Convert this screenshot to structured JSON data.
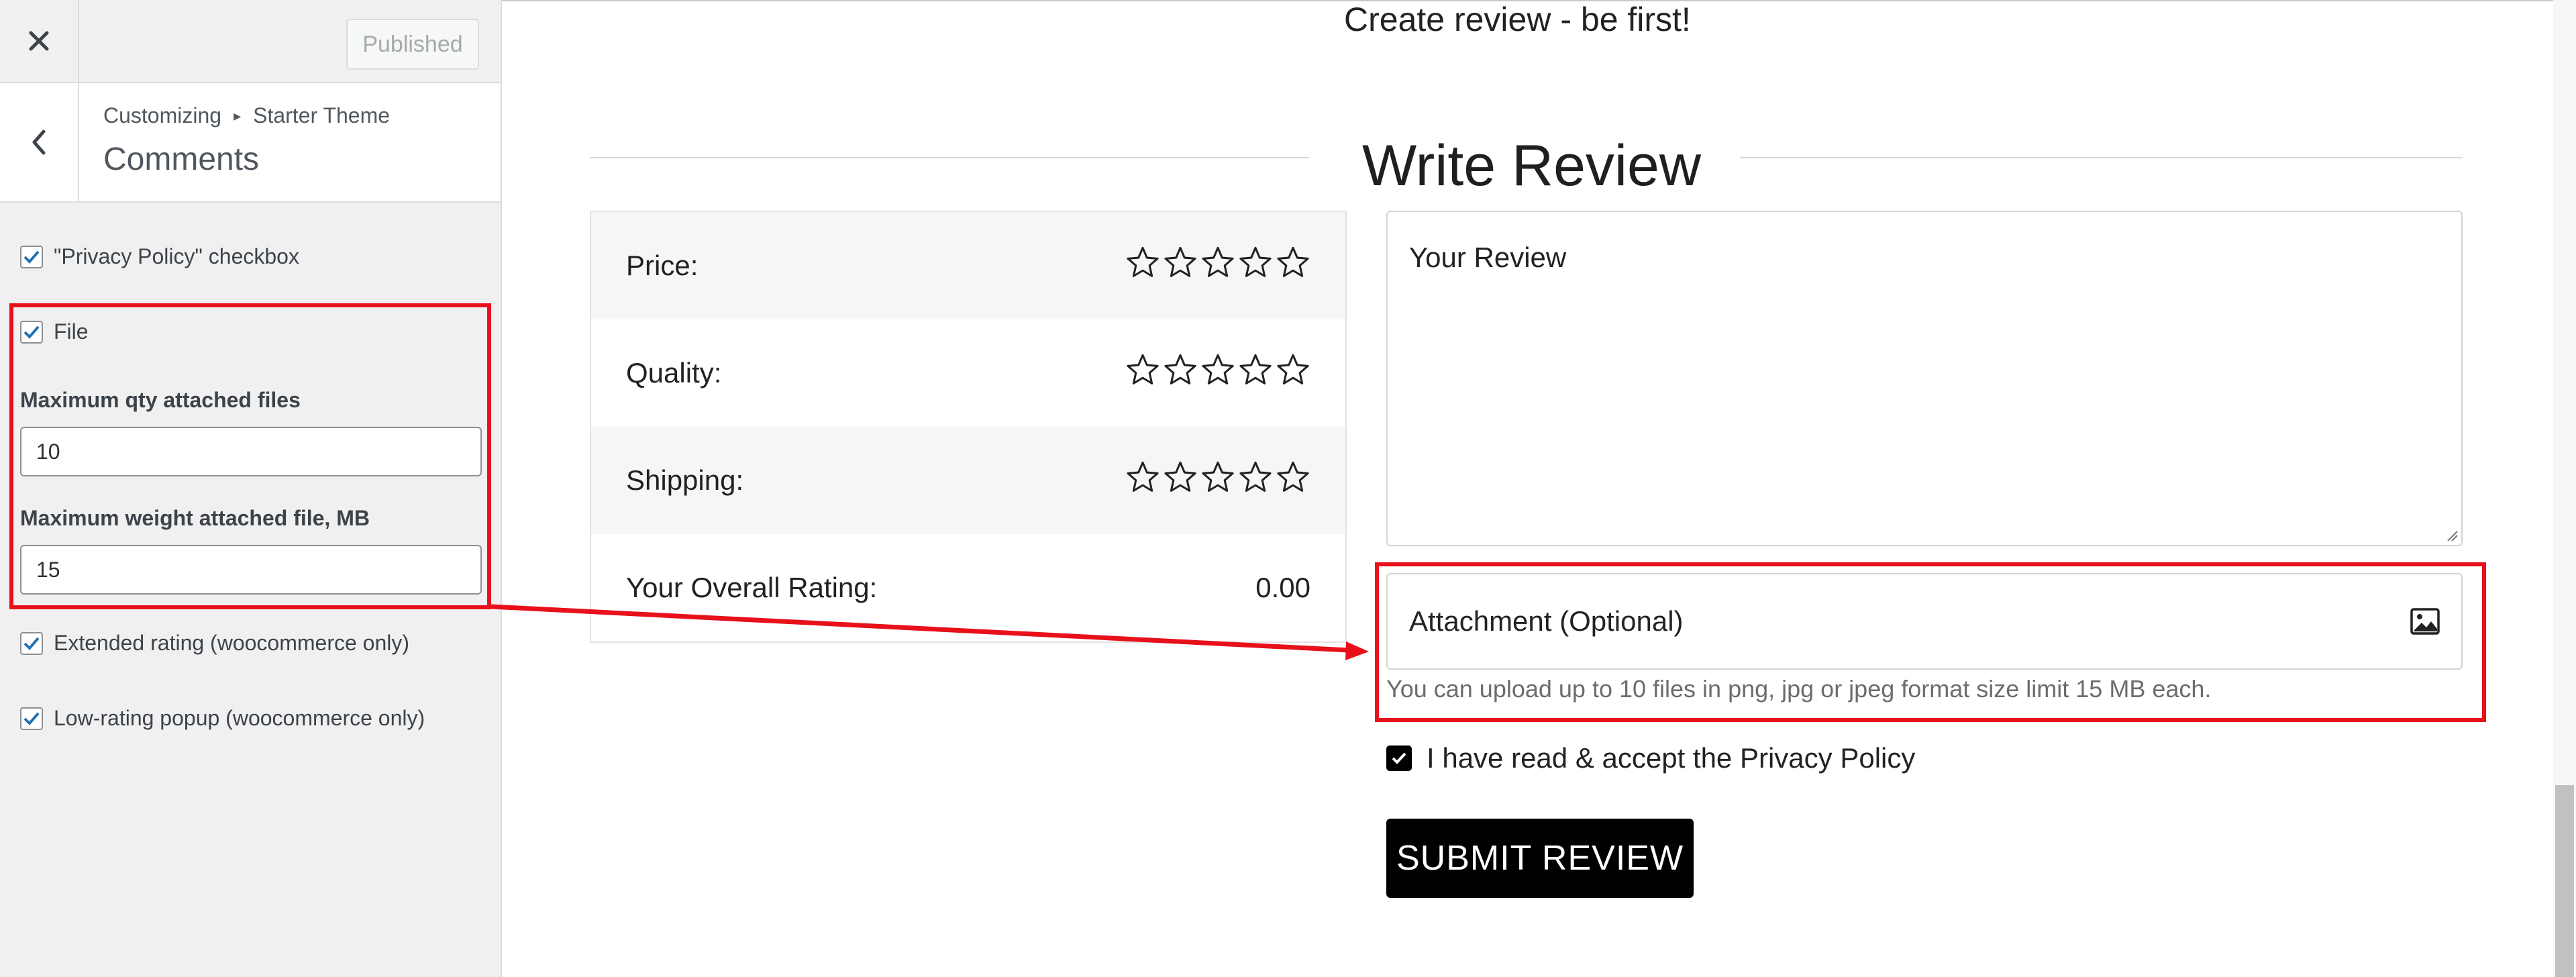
{
  "customizer": {
    "publish_label": "Published",
    "breadcrumb": {
      "root": "Customizing",
      "separator": "▸",
      "theme": "Starter Theme"
    },
    "section_title": "Comments",
    "options": {
      "privacy_label": "\"Privacy Policy\" checkbox",
      "file_label": "File",
      "max_qty_label": "Maximum qty attached files",
      "max_qty_value": "10",
      "max_weight_label": "Maximum weight attached file, MB",
      "max_weight_value": "15",
      "extended_rating_label": "Extended rating (woocommerce only)",
      "low_rating_label": "Low-rating popup (woocommerce only)"
    }
  },
  "preview": {
    "create_title": "Create review - be first!",
    "write_title": "Write Review",
    "ratings": [
      {
        "label": "Price:"
      },
      {
        "label": "Quality:"
      },
      {
        "label": "Shipping:"
      }
    ],
    "overall_label": "Your Overall Rating:",
    "overall_value": "0.00",
    "review_placeholder": "Your Review",
    "attachment_label": "Attachment (Optional)",
    "attachment_hint": "You can upload up to 10 files in png, jpg or jpeg format size limit 15 MB each.",
    "accept_label": "I have read & accept the Privacy Policy",
    "submit_label": "SUBMIT REVIEW"
  },
  "colors": {
    "annotation_red": "#e8101a",
    "wp_blue": "#2271b1",
    "panel_bg": "#f0f0f1"
  }
}
